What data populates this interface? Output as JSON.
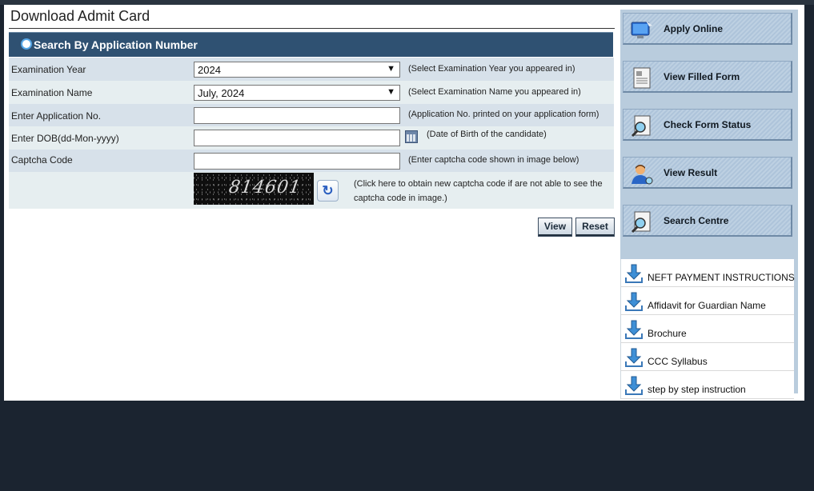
{
  "page": {
    "title": "Download Admit Card",
    "section_title": "Search By Application Number"
  },
  "form": {
    "exam_year": {
      "label": "Examination Year",
      "value": "2024",
      "hint": "(Select Examination Year you appeared in)"
    },
    "exam_name": {
      "label": "Examination Name",
      "value": "July, 2024",
      "hint": "(Select Examination Name you appeared in)"
    },
    "application_no": {
      "label": "Enter Application No.",
      "value": "",
      "hint": "(Application No. printed on your application form)"
    },
    "dob": {
      "label": "Enter DOB(dd-Mon-yyyy)",
      "value": "",
      "hint": "(Date of Birth of the candidate)"
    },
    "captcha": {
      "label": "Captcha Code",
      "value": "",
      "hint": "(Enter captcha code shown in image below)"
    },
    "captcha_image": {
      "text": "814601",
      "refresh_hint": "(Click here to obtain new captcha code if are not able to see the captcha code in image.)"
    },
    "buttons": {
      "view": "View",
      "reset": "Reset"
    }
  },
  "sidebar": {
    "menu": [
      {
        "label": "Apply Online",
        "icon": "computer-icon"
      },
      {
        "label": "View Filled Form",
        "icon": "document-icon"
      },
      {
        "label": "Check Form Status",
        "icon": "magnifier-document-icon"
      },
      {
        "label": "View Result",
        "icon": "user-icon"
      },
      {
        "label": "Search Centre",
        "icon": "magnifier-document-icon"
      }
    ],
    "downloads": [
      "NEFT PAYMENT INSTRUCTIONS",
      "Affidavit for Guardian Name",
      "Brochure",
      "CCC Syllabus",
      "step by step instruction"
    ]
  },
  "colors": {
    "header": "#2f5172",
    "row_a": "#d7e1ea",
    "row_b": "#e6eef0",
    "sidebar": "#b9ccdd",
    "background": "#1b2430"
  }
}
